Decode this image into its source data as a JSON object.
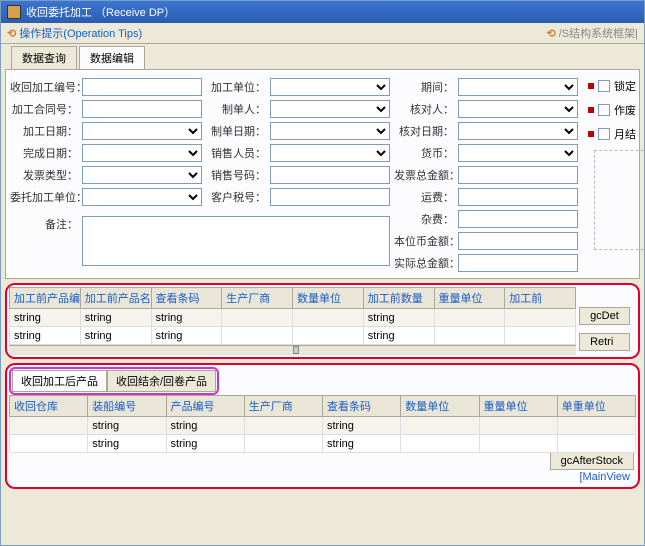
{
  "window": {
    "title": "收回委托加工 （Receive DP）"
  },
  "toolbar": {
    "tip_icon": "⟲",
    "tip_text": "操作提示(Operation Tips)",
    "right_icon": "⟲",
    "right_text": "/S结构系统框架|"
  },
  "tabs": [
    "数据查询",
    "数据编辑"
  ],
  "labels": {
    "recover_no": "收回加工编号：",
    "contract_no": "加工合同号：",
    "process_date": "加工日期：",
    "finish_date": "完成日期：",
    "invoice_type": "发票类型：",
    "entrust_unit": "委托加工单位：",
    "remark": "备注：",
    "process_unit": "加工单位：",
    "maker": "制单人：",
    "make_date": "制单日期：",
    "sales": "销售人员：",
    "sales_no": "销售号码：",
    "cust_tax": "客户税号：",
    "period": "期间：",
    "checker": "核对人：",
    "check_date": "核对日期：",
    "currency": "货币：",
    "inv_total": "发票总金额：",
    "freight": "运费：",
    "misc": "杂费：",
    "local_amt": "本位币金额：",
    "actual_total": "实际总金额："
  },
  "checks": {
    "lock": "锁定",
    "void": "作废",
    "month": "月结"
  },
  "grid1": {
    "headers": [
      "加工前产品编号",
      "加工前产品名称",
      "查看条码",
      "生产厂商",
      "数量单位",
      "加工前数量",
      "重量单位",
      "加工前"
    ],
    "rows": [
      [
        "string",
        "string",
        "string",
        "",
        "",
        "string",
        "",
        ""
      ],
      [
        "string",
        "string",
        "string",
        "",
        "",
        "string",
        "",
        ""
      ]
    ],
    "side_buttons": [
      "gcDet",
      "Retri"
    ]
  },
  "subtabs": [
    "收回加工后产品",
    "收回结余/回卷产品"
  ],
  "grid2": {
    "headers": [
      "收回仓库",
      "装船编号",
      "产品编号",
      "生产厂商",
      "查看条码",
      "数量单位",
      "重量单位",
      "单重单位"
    ],
    "rows": [
      [
        "",
        "string",
        "string",
        "",
        "string",
        "",
        "",
        ""
      ],
      [
        "",
        "string",
        "string",
        "",
        "string",
        "",
        "",
        ""
      ]
    ],
    "side_button": "gcAfterStock"
  },
  "footer": "[MainView"
}
